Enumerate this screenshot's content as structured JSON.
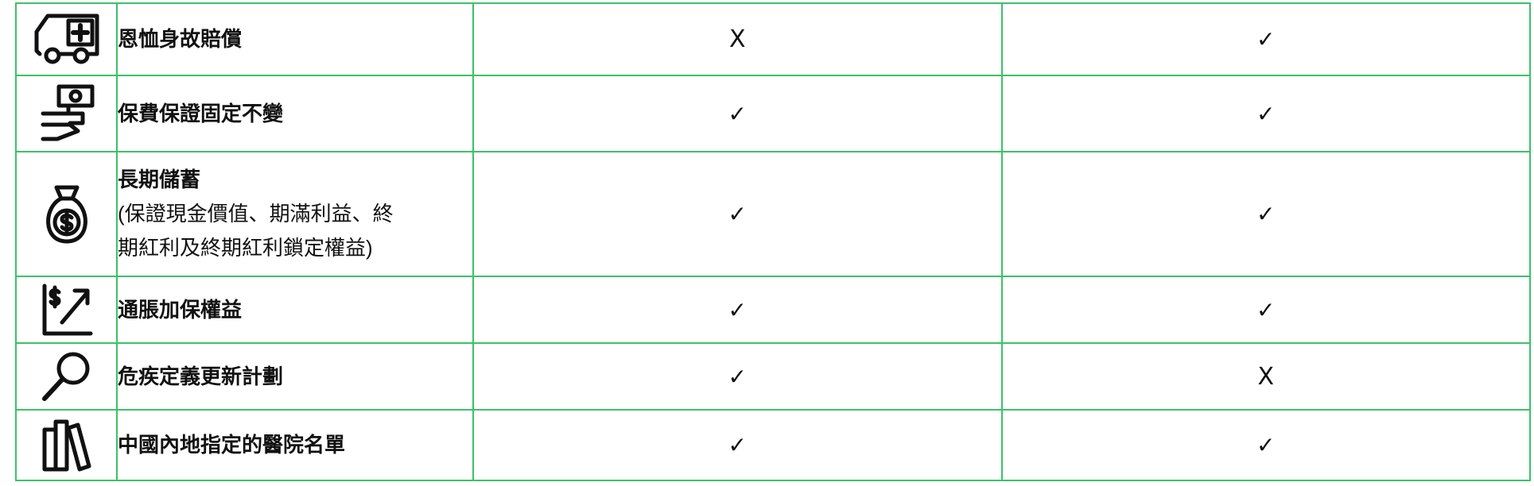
{
  "rows": [
    {
      "icon": "ambulance-icon",
      "label": "恩恤身故賠償",
      "sub_lines": [],
      "col1": "X",
      "col2": "✓"
    },
    {
      "icon": "hand-holding-cash-icon",
      "label": "保費保證固定不變",
      "sub_lines": [],
      "col1": "✓",
      "col2": "✓"
    },
    {
      "icon": "money-bag-icon",
      "label": "長期儲蓄",
      "sub_lines": [
        "(保證現金價值、期滿利益、終",
        "期紅利及終期紅利鎖定權益)"
      ],
      "col1": "✓",
      "col2": "✓"
    },
    {
      "icon": "growth-chart-icon",
      "label": "通脹加保權益",
      "sub_lines": [],
      "col1": "✓",
      "col2": "✓"
    },
    {
      "icon": "magnifier-icon",
      "label": "危疾定義更新計劃",
      "sub_lines": [],
      "col1": "✓",
      "col2": "X"
    },
    {
      "icon": "books-icon",
      "label": "中國內地指定的醫院名單",
      "sub_lines": [],
      "col1": "✓",
      "col2": "✓"
    }
  ],
  "colors": {
    "border": "#3cc16a",
    "text": "#111111"
  }
}
